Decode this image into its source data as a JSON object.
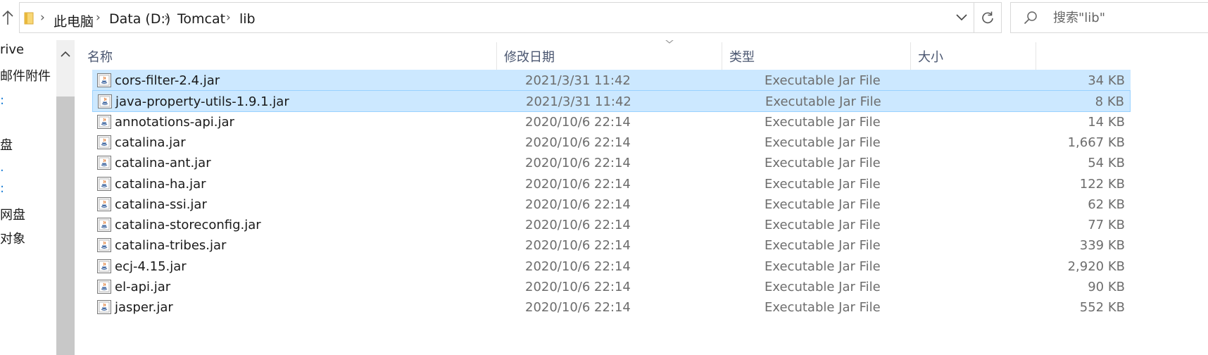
{
  "address": {
    "breadcrumbs": [
      "此电脑",
      "Data (D:)",
      "Tomcat",
      "lib"
    ]
  },
  "search": {
    "placeholder": "搜索\"lib\""
  },
  "nav_pane": {
    "items": [
      {
        "label": "rive",
        "accent": false
      },
      {
        "label": "邮件附件",
        "accent": false
      },
      {
        "label": "盘",
        "accent": false
      },
      {
        "label": "网盘",
        "accent": false
      },
      {
        "label": "对象",
        "accent": false
      }
    ]
  },
  "columns": {
    "name": "名称",
    "modified": "修改日期",
    "type": "类型",
    "size": "大小"
  },
  "files": [
    {
      "name": "cors-filter-2.4.jar",
      "modified": "2021/3/31 11:42",
      "type": "Executable Jar File",
      "size": "34 KB",
      "selected": true
    },
    {
      "name": "java-property-utils-1.9.1.jar",
      "modified": "2021/3/31 11:42",
      "type": "Executable Jar File",
      "size": "8 KB",
      "selected": true
    },
    {
      "name": "annotations-api.jar",
      "modified": "2020/10/6 22:14",
      "type": "Executable Jar File",
      "size": "14 KB",
      "selected": false
    },
    {
      "name": "catalina.jar",
      "modified": "2020/10/6 22:14",
      "type": "Executable Jar File",
      "size": "1,667 KB",
      "selected": false
    },
    {
      "name": "catalina-ant.jar",
      "modified": "2020/10/6 22:14",
      "type": "Executable Jar File",
      "size": "54 KB",
      "selected": false
    },
    {
      "name": "catalina-ha.jar",
      "modified": "2020/10/6 22:14",
      "type": "Executable Jar File",
      "size": "122 KB",
      "selected": false
    },
    {
      "name": "catalina-ssi.jar",
      "modified": "2020/10/6 22:14",
      "type": "Executable Jar File",
      "size": "62 KB",
      "selected": false
    },
    {
      "name": "catalina-storeconfig.jar",
      "modified": "2020/10/6 22:14",
      "type": "Executable Jar File",
      "size": "77 KB",
      "selected": false
    },
    {
      "name": "catalina-tribes.jar",
      "modified": "2020/10/6 22:14",
      "type": "Executable Jar File",
      "size": "339 KB",
      "selected": false
    },
    {
      "name": "ecj-4.15.jar",
      "modified": "2020/10/6 22:14",
      "type": "Executable Jar File",
      "size": "2,920 KB",
      "selected": false
    },
    {
      "name": "el-api.jar",
      "modified": "2020/10/6 22:14",
      "type": "Executable Jar File",
      "size": "90 KB",
      "selected": false
    },
    {
      "name": "jasper.jar",
      "modified": "2020/10/6 22:14",
      "type": "Executable Jar File",
      "size": "552 KB",
      "selected": false
    }
  ],
  "colors": {
    "selection_bg": "#cce8ff",
    "selection_border": "#99d1ff",
    "folder_yellow": "#f8d775",
    "header_text": "#4a5670"
  }
}
